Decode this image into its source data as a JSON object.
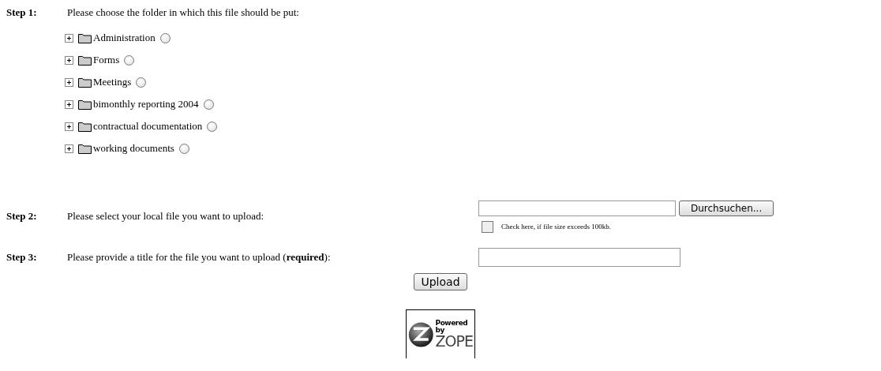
{
  "step1": {
    "label": "Step 1:",
    "text": "Please choose the folder in which this file should be put:",
    "folders": [
      {
        "name": "Administration",
        "expanded": false,
        "selected": false
      },
      {
        "name": "Forms",
        "expanded": false,
        "selected": false
      },
      {
        "name": "Meetings",
        "expanded": false,
        "selected": false
      },
      {
        "name": "bimonthly reporting 2004",
        "expanded": false,
        "selected": false
      },
      {
        "name": "contractual documentation",
        "expanded": false,
        "selected": false
      },
      {
        "name": "working documents",
        "expanded": false,
        "selected": false
      }
    ]
  },
  "step2": {
    "label": "Step 2:",
    "text": "Please select your local file you want to upload:",
    "browse_button": "Durchsuchen...",
    "checkbox": {
      "label": "Check here, if file size exceeds 100kb.",
      "checked": false
    }
  },
  "step3": {
    "label": "Step 3:",
    "text": "Please provide a title for the file you want to upload (**required**):"
  },
  "upload_button": "Upload",
  "logo": {
    "line1": "Powered by",
    "line2": "ZOPE"
  }
}
